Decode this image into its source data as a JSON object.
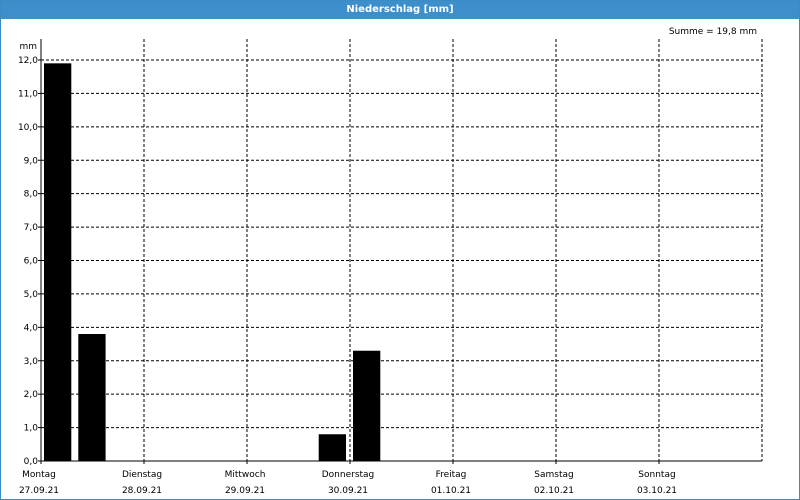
{
  "window": {
    "title": "Niederschlag [mm]"
  },
  "summary": {
    "text": "Summe = 19,8 mm"
  },
  "chart_data": {
    "type": "bar",
    "title": "Niederschlag [mm]",
    "ylabel": "mm",
    "xlabel": "",
    "ylim": [
      0,
      12
    ],
    "y_ticks": [
      "0,0",
      "1,0",
      "2,0",
      "3,0",
      "4,0",
      "5,0",
      "6,0",
      "7,0",
      "8,0",
      "9,0",
      "10,0",
      "11,0",
      "12,0"
    ],
    "days": [
      {
        "name": "Montag",
        "date": "27.09.21"
      },
      {
        "name": "Dienstag",
        "date": "28.09.21"
      },
      {
        "name": "Mittwoch",
        "date": "29.09.21"
      },
      {
        "name": "Donnerstag",
        "date": "30.09.21"
      },
      {
        "name": "Freitag",
        "date": "01.10.21"
      },
      {
        "name": "Samstag",
        "date": "02.10.21"
      },
      {
        "name": "Sonntag",
        "date": "03.10.21"
      }
    ],
    "bar_interval_days": 0.333,
    "bars": [
      {
        "start_day": 0.0,
        "value": 11.9
      },
      {
        "start_day": 0.333,
        "value": 3.8
      },
      {
        "start_day": 2.667,
        "value": 0.8
      },
      {
        "start_day": 3.0,
        "value": 3.3
      }
    ],
    "summary": "Summe = 19,8 mm",
    "grid": true,
    "colors": {
      "bar": "#000000",
      "title_bar": "#3d8fcb",
      "grid": "#000000"
    }
  }
}
